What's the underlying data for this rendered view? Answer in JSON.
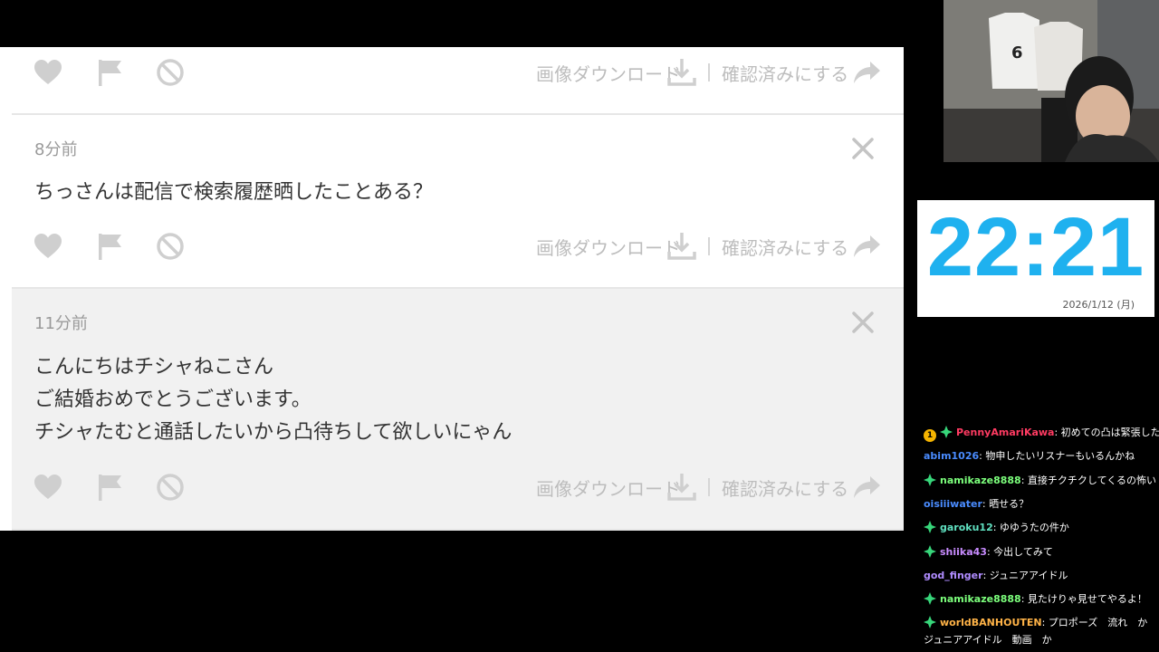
{
  "panel": {
    "actions": {
      "download_label": "画像ダウンロード",
      "confirm_label": "確認済みにする"
    },
    "cards": [
      {
        "time": "8分前",
        "message": [
          "ちっさんは配信で検索履歴晒したことある？"
        ]
      },
      {
        "time": "11分前",
        "message": [
          "こんにちはチシャねこさん",
          "ご結婚おめでとうございます。",
          "チシャたむと通話したいから凸待ちして欲しいにゃん"
        ]
      }
    ]
  },
  "clock": {
    "time": "22:21",
    "date": "2026/1/12 (月)",
    "color": "#1fb1ef"
  },
  "chat": {
    "messages": [
      {
        "user": "PennyAmariKawa",
        "color": "#ff3b62",
        "text": ": 初めての凸は緊張した",
        "badges": [
          "subscriber",
          "gem"
        ]
      },
      {
        "user": "abim1026",
        "color": "#4a8cff",
        "text": ": 物申したいリスナーもいるんかね",
        "badges": []
      },
      {
        "user": "namikaze8888",
        "color": "#7cff7c",
        "text": ": 直接チクチクしてくるの怖い",
        "badges": [
          "gem"
        ]
      },
      {
        "user": "oisiiiwater",
        "color": "#4a8cff",
        "text": ": 晒せる？",
        "badges": []
      },
      {
        "user": "garoku12",
        "color": "#5fe0c0",
        "text": ": ゆゆうたの件か",
        "badges": [
          "gem"
        ]
      },
      {
        "user": "shiika43",
        "color": "#c88cff",
        "text": ": 今出してみて",
        "badges": [
          "gem"
        ]
      },
      {
        "user": "god_finger",
        "color": "#b08cff",
        "text": ": ジュニアアイドル",
        "badges": []
      },
      {
        "user": "namikaze8888",
        "color": "#7cff7c",
        "text": ": 見たけりゃ見せてやるよ！",
        "badges": [
          "gem"
        ]
      },
      {
        "user": "worldBANHOUTEN",
        "color": "#ffb347",
        "text": ": プロポーズ　流れ　か",
        "badges": [
          "gem"
        ]
      }
    ],
    "continuation": "ジュニアアイドル　動画　か"
  }
}
